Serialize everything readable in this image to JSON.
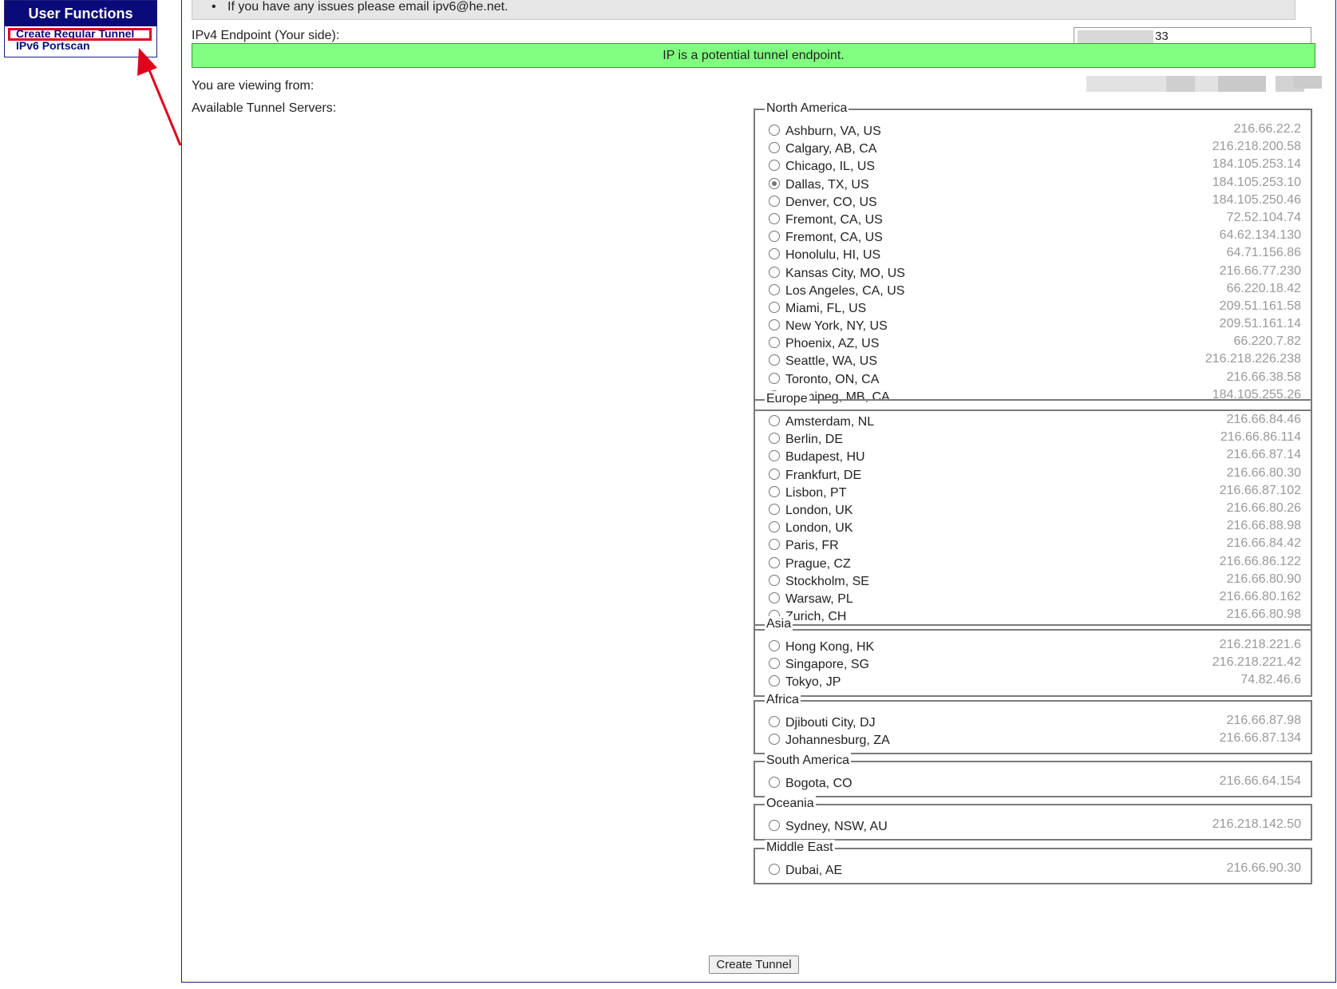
{
  "sidebar": {
    "title": "User Functions",
    "links": [
      "Create Regular Tunnel",
      "IPv6 Portscan"
    ]
  },
  "notice": "If you have any issues please email ipv6@he.net.",
  "endpoint": {
    "label": "IPv4 Endpoint (Your side):",
    "value_visible": "33",
    "status": "IP is a potential tunnel endpoint."
  },
  "viewing_from_label": "You are viewing from:",
  "servers_label": "Available Tunnel Servers:",
  "regions": [
    {
      "name": "North America",
      "servers": [
        {
          "city": "Ashburn, VA, US",
          "ip": "216.66.22.2"
        },
        {
          "city": "Calgary, AB, CA",
          "ip": "216.218.200.58"
        },
        {
          "city": "Chicago, IL, US",
          "ip": "184.105.253.14"
        },
        {
          "city": "Dallas, TX, US",
          "ip": "184.105.253.10",
          "selected": true
        },
        {
          "city": "Denver, CO, US",
          "ip": "184.105.250.46"
        },
        {
          "city": "Fremont, CA, US",
          "ip": "72.52.104.74"
        },
        {
          "city": "Fremont, CA, US",
          "ip": "64.62.134.130"
        },
        {
          "city": "Honolulu, HI, US",
          "ip": "64.71.156.86"
        },
        {
          "city": "Kansas City, MO, US",
          "ip": "216.66.77.230"
        },
        {
          "city": "Los Angeles, CA, US",
          "ip": "66.220.18.42"
        },
        {
          "city": "Miami, FL, US",
          "ip": "209.51.161.58"
        },
        {
          "city": "New York, NY, US",
          "ip": "209.51.161.14"
        },
        {
          "city": "Phoenix, AZ, US",
          "ip": "66.220.7.82"
        },
        {
          "city": "Seattle, WA, US",
          "ip": "216.218.226.238"
        },
        {
          "city": "Toronto, ON, CA",
          "ip": "216.66.38.58"
        },
        {
          "city": "Winnipeg, MB, CA",
          "ip": "184.105.255.26"
        }
      ]
    },
    {
      "name": "Europe",
      "servers": [
        {
          "city": "Amsterdam, NL",
          "ip": "216.66.84.46"
        },
        {
          "city": "Berlin, DE",
          "ip": "216.66.86.114"
        },
        {
          "city": "Budapest, HU",
          "ip": "216.66.87.14"
        },
        {
          "city": "Frankfurt, DE",
          "ip": "216.66.80.30"
        },
        {
          "city": "Lisbon, PT",
          "ip": "216.66.87.102"
        },
        {
          "city": "London, UK",
          "ip": "216.66.80.26"
        },
        {
          "city": "London, UK",
          "ip": "216.66.88.98"
        },
        {
          "city": "Paris, FR",
          "ip": "216.66.84.42"
        },
        {
          "city": "Prague, CZ",
          "ip": "216.66.86.122"
        },
        {
          "city": "Stockholm, SE",
          "ip": "216.66.80.90"
        },
        {
          "city": "Warsaw, PL",
          "ip": "216.66.80.162"
        },
        {
          "city": "Zurich, CH",
          "ip": "216.66.80.98"
        }
      ]
    },
    {
      "name": "Asia",
      "servers": [
        {
          "city": "Hong Kong, HK",
          "ip": "216.218.221.6"
        },
        {
          "city": "Singapore, SG",
          "ip": "216.218.221.42"
        },
        {
          "city": "Tokyo, JP",
          "ip": "74.82.46.6"
        }
      ]
    },
    {
      "name": "Africa",
      "servers": [
        {
          "city": "Djibouti City, DJ",
          "ip": "216.66.87.98"
        },
        {
          "city": "Johannesburg, ZA",
          "ip": "216.66.87.134"
        }
      ]
    },
    {
      "name": "South America",
      "servers": [
        {
          "city": "Bogota, CO",
          "ip": "216.66.64.154"
        }
      ]
    },
    {
      "name": "Oceania",
      "servers": [
        {
          "city": "Sydney, NSW, AU",
          "ip": "216.218.142.50"
        }
      ]
    },
    {
      "name": "Middle East",
      "servers": [
        {
          "city": "Dubai, AE",
          "ip": "216.66.90.30"
        }
      ]
    }
  ],
  "create_button": "Create Tunnel",
  "colors": {
    "sidebar_header": "#0a0a7a",
    "status_ok": "#80ff80",
    "highlight": "#e0001b"
  }
}
